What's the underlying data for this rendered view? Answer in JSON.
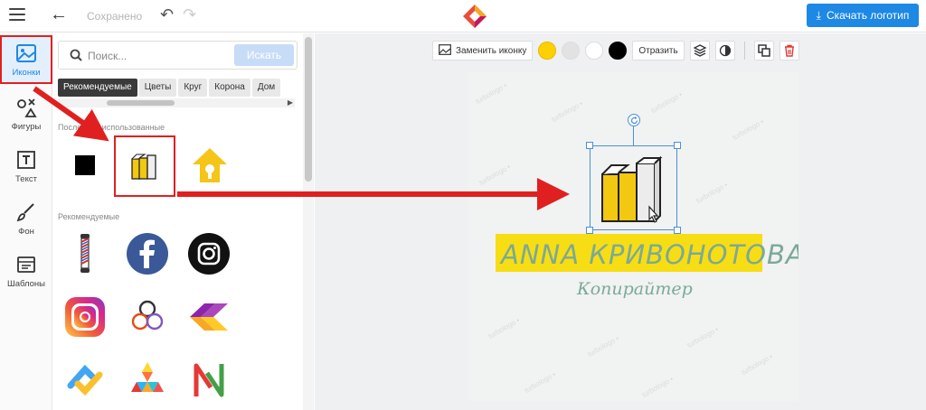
{
  "header": {
    "saved_status": "Сохранено",
    "download_label": "Скачать логотип"
  },
  "rail": {
    "items": [
      {
        "label": "Иконки"
      },
      {
        "label": "Фигуры"
      },
      {
        "label": "Текст"
      },
      {
        "label": "Фон"
      },
      {
        "label": "Шаблоны"
      }
    ]
  },
  "panel": {
    "search_placeholder": "Поиск...",
    "search_button": "Искать",
    "categories": [
      "Рекомендуемые",
      "Цветы",
      "Круг",
      "Корона",
      "Дом"
    ],
    "recent_title": "Последние использованные",
    "recommended_title": "Рекомендуемые"
  },
  "toolbar": {
    "replace_icon_label": "Заменить иконку",
    "mirror_label": "Отразить",
    "colors": [
      "#ffd000",
      "#e2e2e2",
      "#ffffff",
      "#000000"
    ]
  },
  "canvas": {
    "name": "ANNA КРИВОНОТОВА",
    "subtitle": "Копирайтер",
    "accent_color": "#f7dd14",
    "text_color": "#7aaa97"
  },
  "colors": {
    "primary": "#1e88e5",
    "annotation": "#e02020"
  }
}
